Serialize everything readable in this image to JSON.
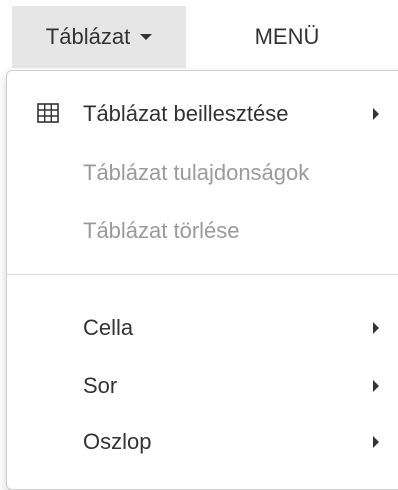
{
  "menubar": {
    "table_label": "Táblázat",
    "menu_label": "MENÜ"
  },
  "dropdown": {
    "insert_table": "Táblázat beillesztése",
    "table_properties": "Táblázat tulajdonságok",
    "delete_table": "Táblázat törlése",
    "cell": "Cella",
    "row": "Sor",
    "column": "Oszlop"
  },
  "colors": {
    "active_menu_bg": "#e6e6e6",
    "disabled_text": "#9a9a9a",
    "text": "#333333"
  },
  "icons": {
    "insert_table": "table-grid-icon",
    "submenu": "caret-right-icon",
    "menu_caret": "caret-down-icon"
  }
}
